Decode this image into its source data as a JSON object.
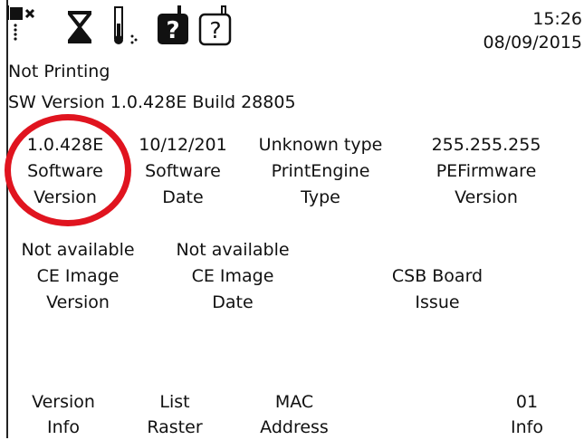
{
  "header": {
    "time": "15:26",
    "date": "08/09/2015",
    "icons": [
      "ink-cartridge-x-icon",
      "hourglass-icon",
      "temperature-icon",
      "help-dark-icon",
      "help-outline-icon"
    ]
  },
  "status": {
    "printing_state": "Not Printing",
    "sw_version_line": "SW Version 1.0.428E Build 28805"
  },
  "info_grid_row1": [
    {
      "value": "1.0.428E",
      "label_line1": "Software",
      "label_line2": "Version"
    },
    {
      "value": "10/12/201",
      "label_line1": "Software",
      "label_line2": "Date"
    },
    {
      "value": "Unknown type",
      "label_line1": "PrintEngine",
      "label_line2": "Type"
    },
    {
      "value": "255.255.255",
      "label_line1": "PEFirmware",
      "label_line2": "Version"
    }
  ],
  "info_grid_row2": [
    {
      "value": "Not available",
      "label_line1": "CE Image",
      "label_line2": "Version"
    },
    {
      "value": "Not available",
      "label_line1": "CE Image",
      "label_line2": "Date"
    },
    {
      "value": "",
      "label_line1": "CSB Board",
      "label_line2": "Issue"
    }
  ],
  "softkeys": [
    {
      "line1": "Version",
      "line2": "Info"
    },
    {
      "line1": "List",
      "line2": "Raster"
    },
    {
      "line1": "MAC",
      "line2": "Address"
    },
    {
      "line1": "01",
      "line2": "Info"
    }
  ],
  "colors": {
    "annotation_circle": "#e0141f",
    "text": "#111111",
    "background": "#ffffff"
  }
}
